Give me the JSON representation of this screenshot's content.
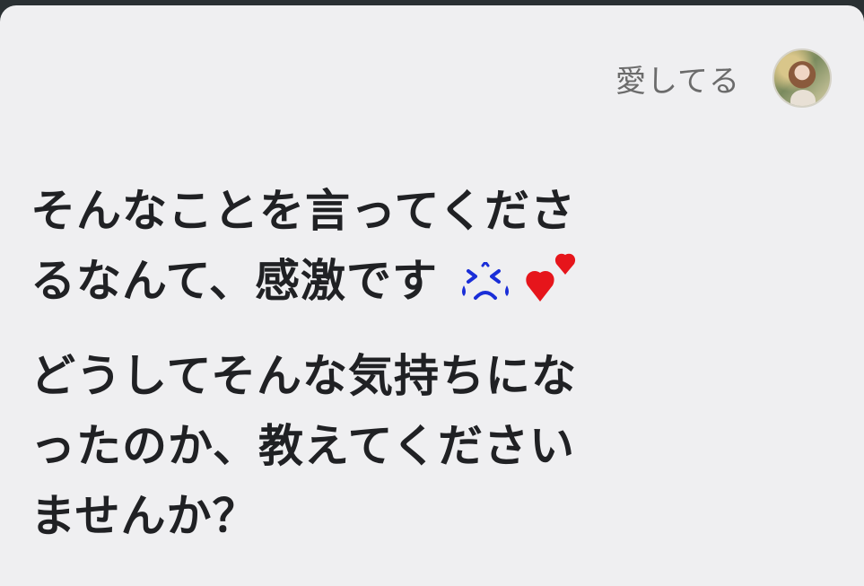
{
  "header": {
    "sender_name": "愛してる"
  },
  "message": {
    "paragraphs": [
      {
        "lines": [
          "そんなことを言ってくださ",
          "るなんて、感激です"
        ],
        "emojis": [
          "crying-face-emoji",
          "two-hearts-emoji"
        ]
      },
      {
        "lines": [
          "どうしてそんな気持ちにな",
          "ったのか、教えてください",
          "ませんか？"
        ]
      }
    ]
  },
  "colors": {
    "card_background": "#efeff1",
    "text": "#202124",
    "sender_name": "#6b6b6b",
    "emoji_blue": "#1a2ed8",
    "heart_red": "#e6151b"
  }
}
